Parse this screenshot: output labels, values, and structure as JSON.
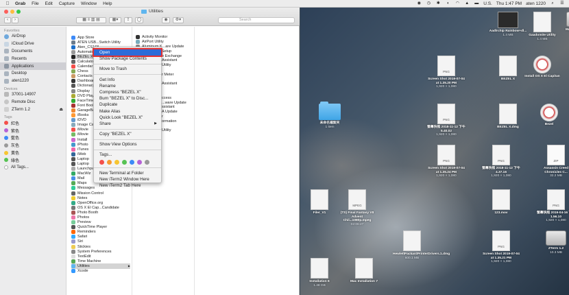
{
  "menubar": {
    "app": "Grab",
    "items": [
      "File",
      "Edit",
      "Capture",
      "Window",
      "Help"
    ],
    "status": {
      "input_source": "U.S.",
      "clock": "Thu 1:47 PM",
      "user": "aten 1220"
    }
  },
  "finder": {
    "title": "Utilities",
    "search_placeholder": "Search",
    "sidebar": {
      "favorites_heading": "Favorites",
      "favorites": [
        "AirDrop",
        "iCloud Drive",
        "Documents",
        "Recents",
        "Applications",
        "Desktop",
        "aten1220"
      ],
      "devices_heading": "Devices",
      "devices": [
        "37001-14907",
        "Remote Disc",
        "ZTerm 1.2"
      ],
      "tags_heading": "Tags",
      "tags": [
        {
          "name": "紅色",
          "color": "#f4504b"
        },
        {
          "name": "紫色",
          "color": "#b562d6"
        },
        {
          "name": "藍色",
          "color": "#3d8af7"
        },
        {
          "name": "灰色",
          "color": "#999999"
        },
        {
          "name": "黃色",
          "color": "#f7c531"
        },
        {
          "name": "綠色",
          "color": "#56c253"
        },
        {
          "name": "All Tags...",
          "color": ""
        }
      ]
    },
    "apps": [
      "App Store",
      "ATEN USB...Switch Utility",
      "Aten_CS168",
      "Automator",
      "BEZEL X",
      "Calculator",
      "Calendar",
      "Chess",
      "Contacts",
      "Dashboard",
      "Dictionary",
      "Display",
      "DVD Player",
      "FaceTime",
      "Font Book",
      "GarageBand",
      "iBooks",
      "iDVD",
      "Image Capture",
      "iMovie",
      "iMovie",
      "Install",
      "iPhoto",
      "iTunes",
      "iWeb",
      "Laptop",
      "Laptop",
      "Launchpad",
      "MacWiz",
      "Mail",
      "Maps",
      "Messages",
      "Mission Control",
      "Notes",
      "OpenOffice.org",
      "OS X El Cap...Candidate",
      "Photo Booth",
      "Photos",
      "Preview",
      "QuickTime Player",
      "Reminders",
      "Safari",
      "Siri",
      "Stickies",
      "System Preferences",
      "TextEdit",
      "Time Machine",
      "Utilities",
      "Xcode"
    ],
    "utilities": [
      "Activity Monitor",
      "AirPort Utility",
      "Aluminum K...are Update",
      "Audio MIDI Setup",
      "e Exchange",
      "Assistant",
      "Utility",
      "",
      "r Meter",
      "",
      "Assistant",
      "",
      "",
      "ccess",
      "...ware Update",
      "ssistant",
      "A Update",
      "r",
      "ormation",
      "",
      "Utility"
    ]
  },
  "context_menu": {
    "items": [
      "Open",
      "Show Package Contents",
      "Move to Trash",
      "Get Info",
      "Rename",
      "Compress \"BEZEL X\"",
      "Burn \"BEZEL X\" to Disc...",
      "Duplicate",
      "Make Alias",
      "Quick Look \"BEZEL X\"",
      "Share",
      "Copy \"BEZEL X\"",
      "Show View Options",
      "Tags...",
      "New Terminal at Folder",
      "New iTerm2 Window Here",
      "New iTerm2 Tab Here"
    ],
    "tag_colors": [
      "#f4504b",
      "#f79a2f",
      "#f7c531",
      "#56c253",
      "#3d8af7",
      "#b562d6",
      "#999999"
    ],
    "highlight_color": "#2d6cd8"
  },
  "desktop": {
    "icons": [
      {
        "label": "Aadlrchip Rainbow+dl...",
        "sub": "1.4 MB",
        "kind": "thumb"
      },
      {
        "label": "Gaadomite Utility",
        "sub": "1.4 MB",
        "kind": "file"
      },
      {
        "label": "Macintosh HD",
        "sub": "",
        "kind": "disk"
      },
      {
        "label": "Screen Shot 2019-07-04 at 1.35.20 PM",
        "sub": "1,920 × 1,080",
        "kind": "png"
      },
      {
        "label": "BEZEL X",
        "sub": "",
        "kind": "file"
      },
      {
        "label": "Install OS X El Capitan",
        "sub": "",
        "kind": "app"
      },
      {
        "label": "未命名檔案夾",
        "sub": "1 item",
        "kind": "folder"
      },
      {
        "label": "螢幕快照 2018-11-12 下午 5.40.02",
        "sub": "1,920 × 1,080",
        "kind": "png"
      },
      {
        "label": "BEZEL X.dmg",
        "sub": "",
        "kind": "file"
      },
      {
        "label": "Bezel",
        "sub": "",
        "kind": "app"
      },
      {
        "label": "螢幕快照 2018-11-12 下午 4.37.16",
        "sub": "1,920 × 1,080",
        "kind": "png"
      },
      {
        "label": "Screen Shot 2019-07-04 at 1.35.24 PM",
        "sub": "1,920 × 1,080",
        "kind": "png"
      },
      {
        "label": "Assassin Creed Chronicles C...",
        "sub": "32.2 MB",
        "kind": "zip"
      },
      {
        "label": "Filer_V1",
        "sub": "",
        "kind": "file"
      },
      {
        "label": "(TS) Final Fantasy VII Advent Chil...1080p.mpeg",
        "sub": "02:06:27",
        "kind": "mpeg"
      },
      {
        "label": "123.mov",
        "sub": "",
        "kind": "file"
      },
      {
        "label": "螢幕快照 2019-04-16 下午 1.56.10",
        "sub": "1,920 × 1,080",
        "kind": "png"
      },
      {
        "label": "HewlettPackardPrinterDrivers.1.dmg",
        "sub": "600.1 MB",
        "kind": "file"
      },
      {
        "label": "Screen Shot 2019-07-04 at 1.35.21 PM",
        "sub": "1,920 × 1,080",
        "kind": "png"
      },
      {
        "label": "ZTerm 1.2",
        "sub": "10.3 MB",
        "kind": "disk"
      },
      {
        "label": "Installation 6",
        "sub": "1.48 GB",
        "kind": "file"
      },
      {
        "label": "Mac Installation 7",
        "sub": "",
        "kind": "file"
      }
    ]
  }
}
